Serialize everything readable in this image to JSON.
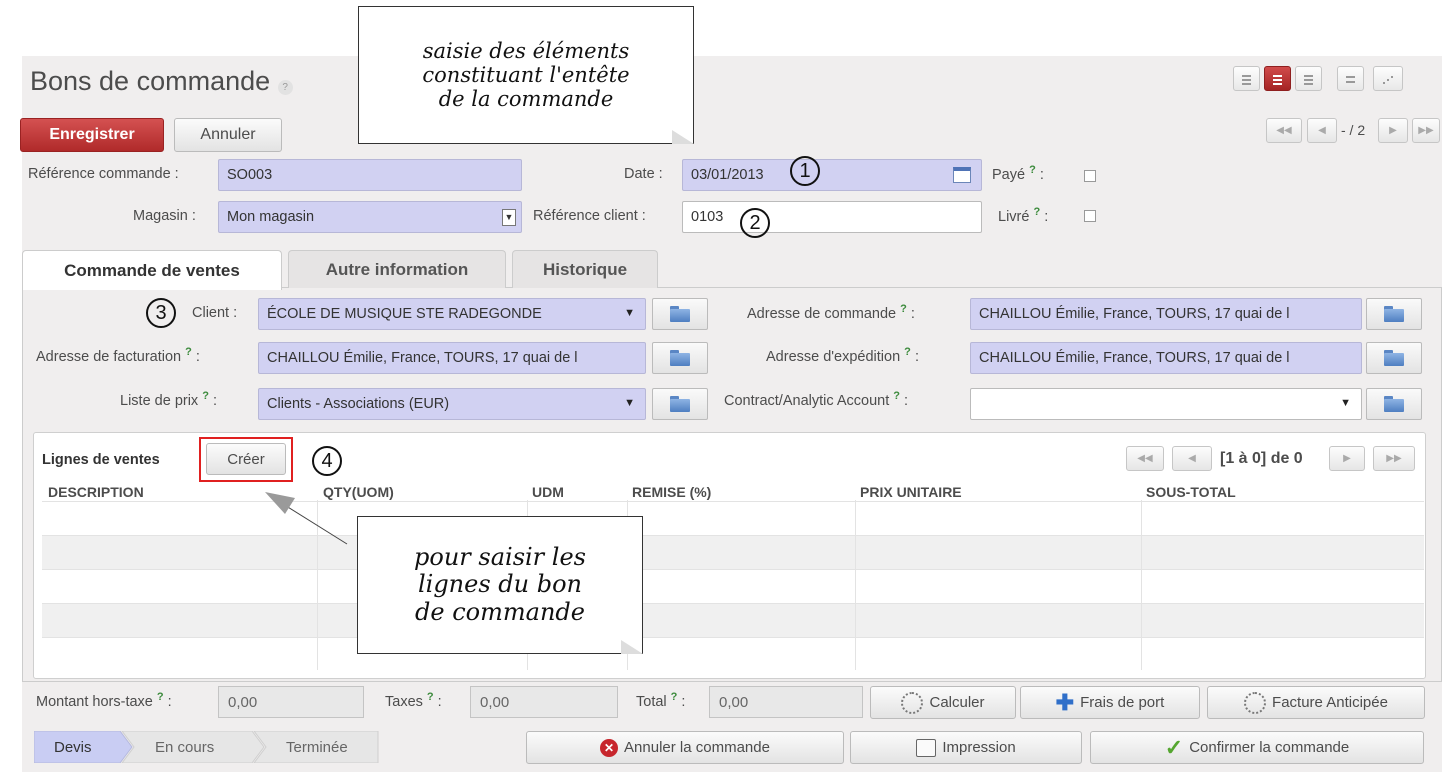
{
  "header": {
    "title": "Bons de commande",
    "help": "?",
    "save_label": "Enregistrer",
    "cancel_label": "Annuler",
    "pager_text": "- / 2"
  },
  "annotations": {
    "top_callout": "saisie des éléments\nconstituant l'entête\nde la commande",
    "lines_callout": "pour saisir les\nlignes du bon\nde commande",
    "num1": "1",
    "num2": "2",
    "num3": "3",
    "num4": "4"
  },
  "form": {
    "ref_label": "Référence commande :",
    "ref_value": "SO003",
    "date_label": "Date :",
    "date_value": "03/01/2013",
    "paid_label": "Payé",
    "shop_label": "Magasin :",
    "shop_value": "Mon magasin",
    "client_ref_label": "Référence client :",
    "client_ref_value": "0103",
    "delivered_label": "Livré",
    "help_mark": "?",
    "colon": ":"
  },
  "tabs": [
    {
      "label": "Commande de ventes"
    },
    {
      "label": "Autre information"
    },
    {
      "label": "Historique"
    }
  ],
  "sales": {
    "client_label": "Client :",
    "client_value": "ÉCOLE DE MUSIQUE STE RADEGONDE",
    "order_addr_label": "Adresse de commande",
    "order_addr_value": "CHAILLOU Émilie, France, TOURS, 17 quai de l",
    "invoice_addr_label": "Adresse de facturation",
    "invoice_addr_value": "CHAILLOU Émilie, France, TOURS, 17 quai de l",
    "ship_addr_label": "Adresse d'expédition",
    "ship_addr_value": "CHAILLOU Émilie, France, TOURS, 17 quai de l",
    "pricelist_label": "Liste de prix",
    "pricelist_value": "Clients - Associations (EUR)",
    "analytic_label": "Contract/Analytic Account",
    "analytic_value": ""
  },
  "lines": {
    "title": "Lignes de ventes",
    "create_label": "Créer",
    "pager_text": "[1 à 0] de 0",
    "columns": [
      "DESCRIPTION",
      "QTY(UOM)",
      "UDM",
      "REMISE (%)",
      "PRIX UNITAIRE",
      "SOUS-TOTAL"
    ]
  },
  "totals": {
    "untaxed_label": "Montant hors-taxe",
    "untaxed_value": "0,00",
    "taxes_label": "Taxes",
    "taxes_value": "0,00",
    "total_label": "Total",
    "total_value": "0,00",
    "compute_label": "Calculer",
    "shipping_label": "Frais de port",
    "advance_label": "Facture Anticipée"
  },
  "status": {
    "steps": [
      "Devis",
      "En cours",
      "Terminée"
    ],
    "cancel_order_label": "Annuler la commande",
    "print_label": "Impression",
    "confirm_label": "Confirmer la commande"
  },
  "colors": {
    "primary": "#b52e2e",
    "field_bg": "#d1d1f2",
    "highlight": "#e02020",
    "active_step": "#c9cdf3"
  }
}
